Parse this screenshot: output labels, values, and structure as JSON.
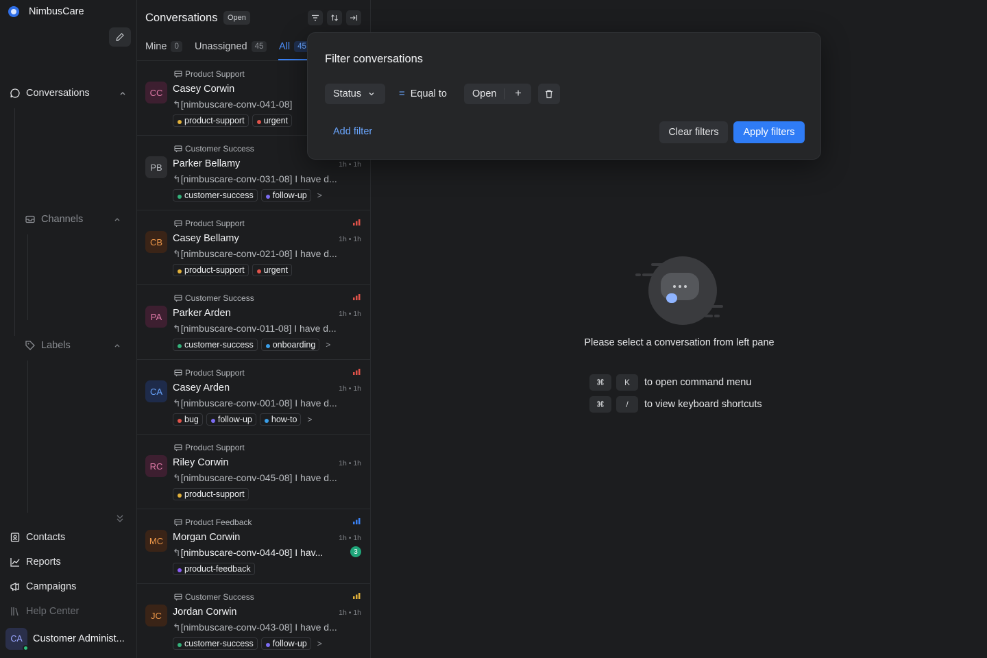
{
  "brand": {
    "name": "NimbusCare"
  },
  "sidebar": {
    "conversations": "Conversations",
    "channels": "Channels",
    "labels": "Labels",
    "bottom": [
      {
        "label": "Contacts",
        "icon": "contacts-icon"
      },
      {
        "label": "Reports",
        "icon": "reports-icon"
      },
      {
        "label": "Campaigns",
        "icon": "campaigns-icon"
      },
      {
        "label": "Help Center",
        "icon": "help-center-icon"
      }
    ],
    "user": {
      "initials": "CA",
      "name": "Customer Administ..."
    }
  },
  "list": {
    "title": "Conversations",
    "status_badge": "Open",
    "tabs": [
      {
        "label": "Mine",
        "count": "0"
      },
      {
        "label": "Unassigned",
        "count": "45"
      },
      {
        "label": "All",
        "count": "45"
      }
    ],
    "conversations": [
      {
        "initials": "CC",
        "avatar_bg": "#3d1f30",
        "avatar_fg": "#e07aa8",
        "inbox": "Product Support",
        "name": "Casey Corwin",
        "time": "",
        "snippet": "[nimbuscare-conv-041-08]",
        "labels": [
          {
            "t": "product-support",
            "c": "#e1b03a"
          },
          {
            "t": "urgent",
            "c": "#e0534a"
          }
        ],
        "more": ""
      },
      {
        "initials": "PB",
        "avatar_bg": "#2d2e31",
        "avatar_fg": "#b8bbc0",
        "inbox": "Customer Success",
        "name": "Parker Bellamy",
        "time": "1h • 1h",
        "snippet": "[nimbuscare-conv-031-08] I have d...",
        "labels": [
          {
            "t": "customer-success",
            "c": "#34b27b"
          },
          {
            "t": "follow-up",
            "c": "#7c6cf2"
          }
        ],
        "more": ">"
      },
      {
        "initials": "CB",
        "avatar_bg": "#3a2417",
        "avatar_fg": "#f0994a",
        "inbox": "Product Support",
        "name": "Casey Bellamy",
        "time": "1h • 1h",
        "snippet": "[nimbuscare-conv-021-08] I have d...",
        "labels": [
          {
            "t": "product-support",
            "c": "#e1b03a"
          },
          {
            "t": "urgent",
            "c": "#e0534a"
          }
        ],
        "more": "",
        "prio": "#e0534a"
      },
      {
        "initials": "PA",
        "avatar_bg": "#3d1f30",
        "avatar_fg": "#e07aa8",
        "inbox": "Customer Success",
        "name": "Parker Arden",
        "time": "1h • 1h",
        "snippet": "[nimbuscare-conv-011-08] I have d...",
        "labels": [
          {
            "t": "customer-success",
            "c": "#34b27b"
          },
          {
            "t": "onboarding",
            "c": "#3a9ee8"
          }
        ],
        "more": ">",
        "prio": "#e0534a"
      },
      {
        "initials": "CA",
        "avatar_bg": "#1e2b4a",
        "avatar_fg": "#6aa6ff",
        "inbox": "Product Support",
        "name": "Casey Arden",
        "time": "1h • 1h",
        "snippet": "[nimbuscare-conv-001-08] I have d...",
        "labels": [
          {
            "t": "bug",
            "c": "#e0534a"
          },
          {
            "t": "follow-up",
            "c": "#7c6cf2"
          },
          {
            "t": "how-to",
            "c": "#3a9ee8"
          }
        ],
        "more": ">",
        "prio": "#e0534a"
      },
      {
        "initials": "RC",
        "avatar_bg": "#3d1f30",
        "avatar_fg": "#e07aa8",
        "inbox": "Product Support",
        "name": "Riley Corwin",
        "time": "1h • 1h",
        "snippet": "[nimbuscare-conv-045-08] I have d...",
        "labels": [
          {
            "t": "product-support",
            "c": "#e1b03a"
          }
        ],
        "more": ""
      },
      {
        "initials": "MC",
        "avatar_bg": "#3a2417",
        "avatar_fg": "#f0994a",
        "inbox": "Product Feedback",
        "name": "Morgan Corwin",
        "time": "1h • 1h",
        "snippet": "[nimbuscare-conv-044-08] I hav...",
        "bold": true,
        "unread": "3",
        "labels": [
          {
            "t": "product-feedback",
            "c": "#8b5cf6"
          }
        ],
        "more": "",
        "prio": "#3a82f6"
      },
      {
        "initials": "JC",
        "avatar_bg": "#3a2417",
        "avatar_fg": "#f0994a",
        "inbox": "Customer Success",
        "name": "Jordan Corwin",
        "time": "1h • 1h",
        "snippet": "[nimbuscare-conv-043-08] I have d...",
        "labels": [
          {
            "t": "customer-success",
            "c": "#34b27b"
          },
          {
            "t": "follow-up",
            "c": "#7c6cf2"
          }
        ],
        "more": ">",
        "prio": "#e1b03a"
      }
    ]
  },
  "main": {
    "empty_text": "Please select a conversation from left pane",
    "shortcuts": [
      {
        "k1": "⌘",
        "k2": "K",
        "text": "to open command menu"
      },
      {
        "k1": "⌘",
        "k2": "/",
        "text": "to view keyboard shortcuts"
      }
    ]
  },
  "filter": {
    "title": "Filter conversations",
    "field": "Status",
    "operator": "Equal to",
    "value": "Open",
    "add_filter": "Add filter",
    "clear": "Clear filters",
    "apply": "Apply filters"
  }
}
